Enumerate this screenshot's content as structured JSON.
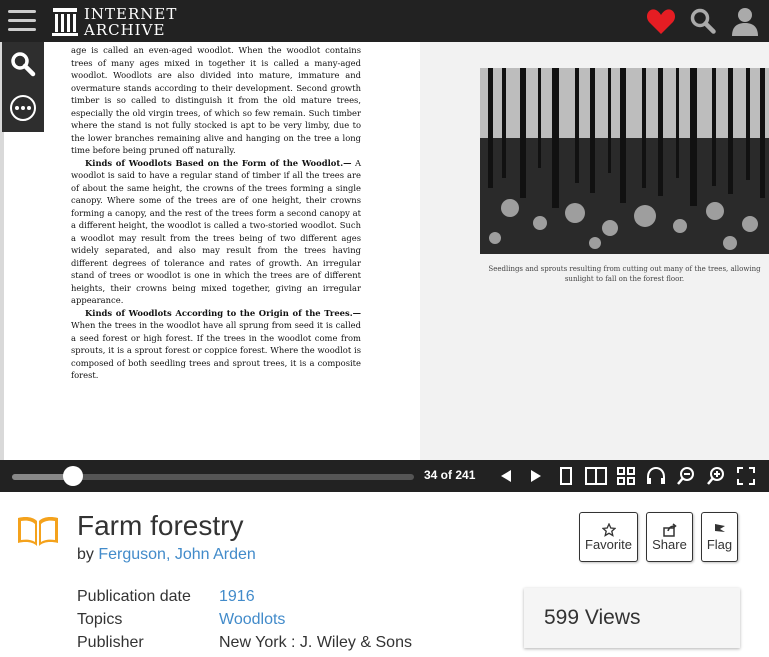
{
  "header": {
    "logo_line1": "INTERNET",
    "logo_line2": "ARCHIVE",
    "icons": [
      "hamburger-menu-icon",
      "heart-icon",
      "search-icon",
      "user-icon"
    ],
    "heart_color": "#e51d23"
  },
  "side_tools": [
    "search-icon",
    "more-options-icon"
  ],
  "book": {
    "left_page_paragraphs": [
      "age is called an even-aged woodlot. When the woodlot contains trees of many ages mixed in together it is called a many-aged woodlot. Woodlots are also divided into mature, immature and overmature stands according to their development. Second growth timber is so called to distinguish it from the old mature trees, especially the old virgin trees, of which so few remain. Such timber where the stand is not fully stocked is apt to be very limby, due to the lower branches remaining alive and hanging on the tree a long time before being pruned off naturally."
    ],
    "section1_heading": "Kinds of Woodlots Based on the Form of the Woodlot.—",
    "section1_text": "A woodlot is said to have a regular stand of timber if all the trees are of about the same height, the crowns of the trees forming a single canopy. Where some of the trees are of one height, their crowns forming a canopy, and the rest of the trees form a second canopy at a different height, the woodlot is called a two-storied woodlot. Such a woodlot may result from the trees being of two different ages widely separated, and also may result from the trees having different degrees of tolerance and rates of growth. An irregular stand of trees or woodlot is one in which the trees are of different heights, their crowns being mixed together, giving an irregular appearance.",
    "section2_heading": "Kinds of Woodlots According to the Origin of the Trees.—",
    "section2_text": "When the trees in the woodlot have all sprung from seed it is called a seed forest or high forest. If the trees in the woodlot come from sprouts, it is a sprout forest or coppice forest. Where the woodlot is composed of both seedling trees and sprout trees, it is a composite forest.",
    "photo_caption": "Seedlings and sprouts resulting from cutting out many of the trees, allowing sunlight to fall on the forest floor."
  },
  "controls": {
    "page_indicator": "34 of 241",
    "progress": 0.141,
    "icons": [
      "previous-page-icon",
      "next-page-icon",
      "one-page-view-icon",
      "two-page-view-icon",
      "thumbnail-view-icon",
      "read-aloud-icon",
      "zoom-out-icon",
      "zoom-in-icon",
      "fullscreen-icon"
    ]
  },
  "item": {
    "title": "Farm forestry",
    "by_prefix": "by",
    "author": "Ferguson, John Arden",
    "actions": [
      {
        "label": "Favorite",
        "icon": "star-icon"
      },
      {
        "label": "Share",
        "icon": "share-icon"
      },
      {
        "label": "Flag",
        "icon": "flag-icon"
      }
    ],
    "metadata": [
      {
        "key": "Publication date",
        "value": "1916",
        "link": true
      },
      {
        "key": "Topics",
        "value": "Woodlots",
        "link": true
      },
      {
        "key": "Publisher",
        "value": "New York : J. Wiley & Sons",
        "link": false
      }
    ],
    "views": "599 Views",
    "accent_color": "#428bca",
    "book_icon_color": "#f4a21c"
  }
}
